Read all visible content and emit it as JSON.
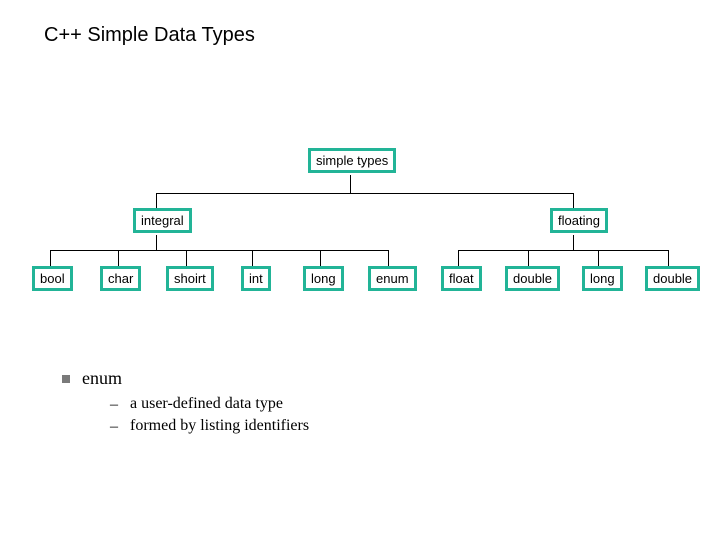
{
  "title": "C++ Simple Data Types",
  "tree": {
    "root": "simple types",
    "mid_left": "integral",
    "mid_right": "floating",
    "leaves": [
      "bool",
      "char",
      "shoirt",
      "int",
      "long",
      "enum",
      "float",
      "double",
      "long",
      "double"
    ]
  },
  "bullets": {
    "l1": "enum",
    "l2": [
      "a user-defined data type",
      "formed by listing identifiers"
    ]
  },
  "colors": {
    "accent": "#22b497"
  }
}
